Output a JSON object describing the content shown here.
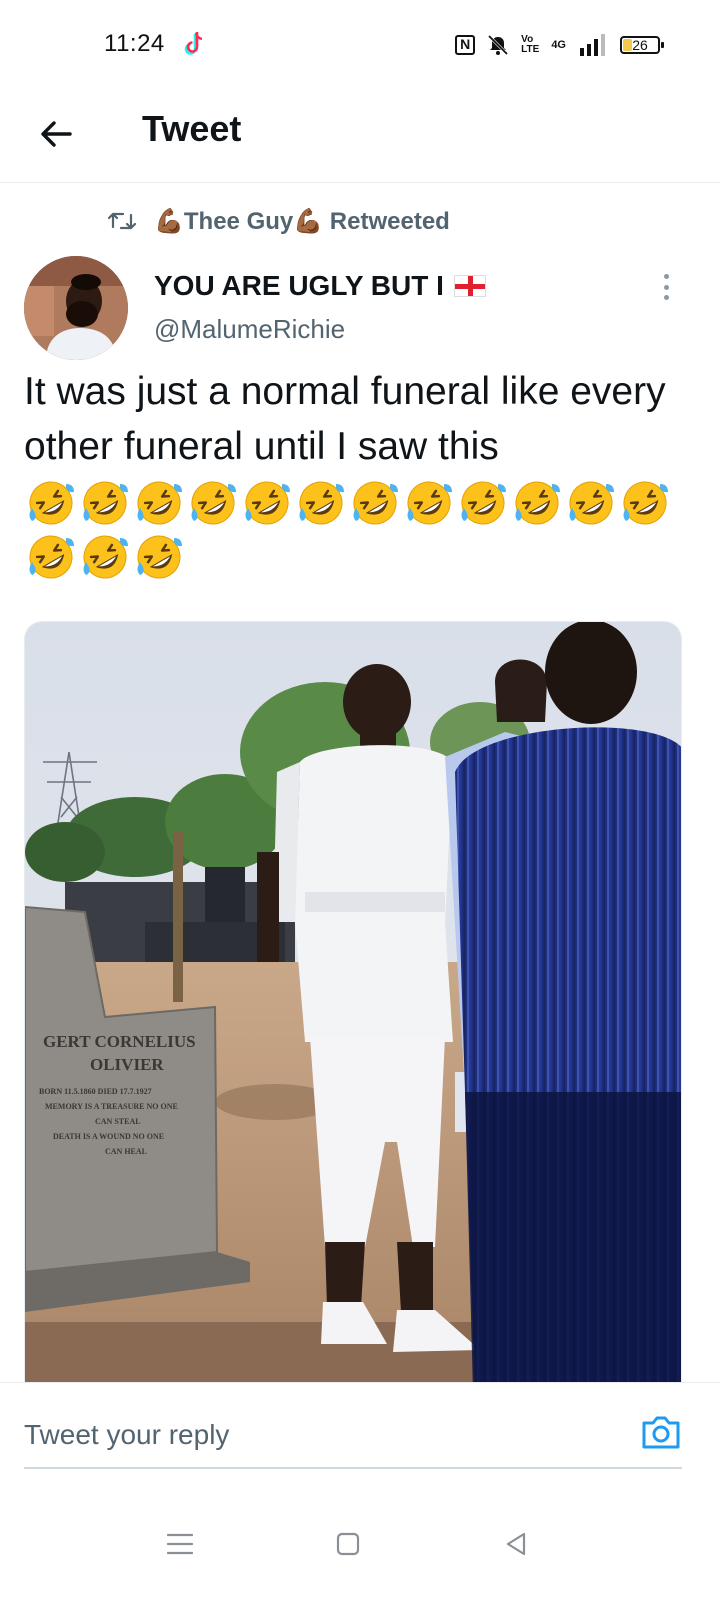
{
  "status_bar": {
    "time": "11:24",
    "app_icon": "tiktok-icon",
    "nfc_label": "N",
    "volte_label": "Vo\nLTE",
    "network_label": "4G",
    "battery_level": "26",
    "battery_fraction": 0.26
  },
  "header": {
    "back_icon": "arrow-left-icon",
    "title": "Tweet"
  },
  "retweet_context": {
    "icon": "retweet-icon",
    "text": "💪🏾Thee Guy💪🏾 Retweeted"
  },
  "tweet": {
    "author_name": "YOU ARE UGLY BUT I",
    "author_flag": "england-flag-icon",
    "handle": "@MalumeRichie",
    "more_icon": "more-vertical-icon",
    "text": "It was just a normal funeral like every other funeral until I saw this",
    "emoji_name": "rolling-on-the-floor-laughing-icon",
    "emoji_count": 15,
    "emoji_rows": [
      12,
      3
    ],
    "photo": {
      "headstone_line1": "GERT CORNELIUS",
      "headstone_line2": "OLIVIER",
      "headstone_line3": "BORN 11.5.1860   DIED 17.7.1927",
      "headstone_line4": "MEMORY IS A TREASURE NO ONE",
      "headstone_line5": "CAN STEAL",
      "headstone_line6": "DEATH IS A WOUND NO ONE",
      "headstone_line7": "CAN HEAL"
    }
  },
  "reply": {
    "placeholder": "Tweet your reply",
    "camera_icon": "camera-icon"
  },
  "nav_bar": {
    "menu_icon": "menu-icon",
    "home_icon": "square-home-icon",
    "back_icon": "triangle-back-icon"
  },
  "colors": {
    "text_primary": "#0f1419",
    "text_secondary": "#536471",
    "accent": "#1d9bf0",
    "divider": "#e6ecf0"
  }
}
